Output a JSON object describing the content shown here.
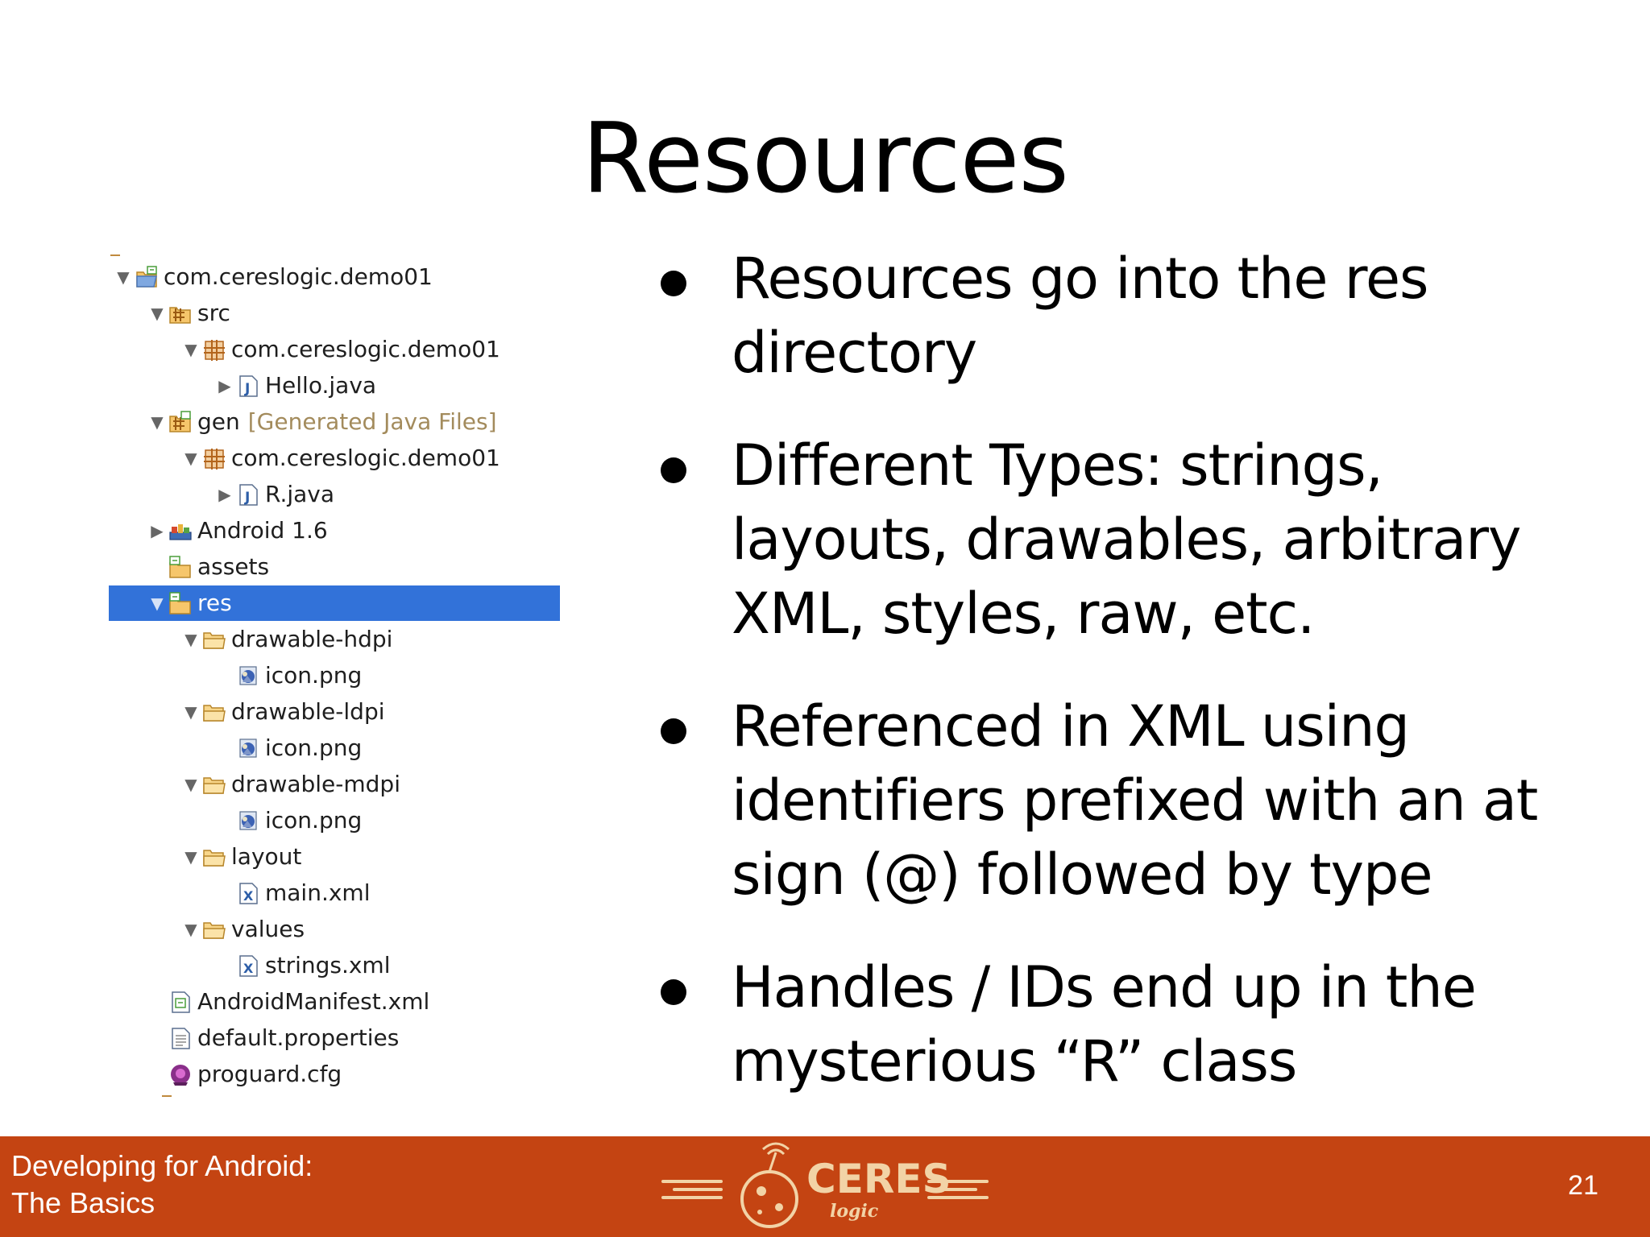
{
  "slide": {
    "title": "Resources",
    "page_number": "21"
  },
  "tree": {
    "items": [
      {
        "label": "com.cereslogic.demo01",
        "suffix": "",
        "icon": "android-project-icon",
        "twisty": "▼",
        "depth": 0,
        "selected": false
      },
      {
        "label": "src",
        "suffix": "",
        "icon": "source-folder-icon",
        "twisty": "▼",
        "depth": 1,
        "selected": false
      },
      {
        "label": "com.cereslogic.demo01",
        "suffix": "",
        "icon": "package-icon",
        "twisty": "▼",
        "depth": 2,
        "selected": false
      },
      {
        "label": "Hello.java",
        "suffix": "",
        "icon": "java-file-icon",
        "twisty": "▶",
        "depth": 3,
        "selected": false
      },
      {
        "label": "gen",
        "suffix": "[Generated Java Files]",
        "icon": "generated-folder-icon",
        "twisty": "▼",
        "depth": 1,
        "selected": false
      },
      {
        "label": "com.cereslogic.demo01",
        "suffix": "",
        "icon": "package-icon",
        "twisty": "▼",
        "depth": 2,
        "selected": false
      },
      {
        "label": "R.java",
        "suffix": "",
        "icon": "java-file-icon",
        "twisty": "▶",
        "depth": 3,
        "selected": false
      },
      {
        "label": "Android 1.6",
        "suffix": "",
        "icon": "library-icon",
        "twisty": "▶",
        "depth": 1,
        "selected": false
      },
      {
        "label": "assets",
        "suffix": "",
        "icon": "android-folder-icon",
        "twisty": "",
        "depth": 1,
        "selected": false
      },
      {
        "label": "res",
        "suffix": "",
        "icon": "android-folder-icon",
        "twisty": "▼",
        "depth": 1,
        "selected": true
      },
      {
        "label": "drawable-hdpi",
        "suffix": "",
        "icon": "folder-icon",
        "twisty": "▼",
        "depth": 2,
        "selected": false
      },
      {
        "label": "icon.png",
        "suffix": "",
        "icon": "image-file-icon",
        "twisty": "",
        "depth": 3,
        "selected": false
      },
      {
        "label": "drawable-ldpi",
        "suffix": "",
        "icon": "folder-icon",
        "twisty": "▼",
        "depth": 2,
        "selected": false
      },
      {
        "label": "icon.png",
        "suffix": "",
        "icon": "image-file-icon",
        "twisty": "",
        "depth": 3,
        "selected": false
      },
      {
        "label": "drawable-mdpi",
        "suffix": "",
        "icon": "folder-icon",
        "twisty": "▼",
        "depth": 2,
        "selected": false
      },
      {
        "label": "icon.png",
        "suffix": "",
        "icon": "image-file-icon",
        "twisty": "",
        "depth": 3,
        "selected": false
      },
      {
        "label": "layout",
        "suffix": "",
        "icon": "folder-icon",
        "twisty": "▼",
        "depth": 2,
        "selected": false
      },
      {
        "label": "main.xml",
        "suffix": "",
        "icon": "xml-file-icon",
        "twisty": "",
        "depth": 3,
        "selected": false
      },
      {
        "label": "values",
        "suffix": "",
        "icon": "folder-icon",
        "twisty": "▼",
        "depth": 2,
        "selected": false
      },
      {
        "label": "strings.xml",
        "suffix": "",
        "icon": "xml-file-icon",
        "twisty": "",
        "depth": 3,
        "selected": false
      },
      {
        "label": "AndroidManifest.xml",
        "suffix": "",
        "icon": "manifest-file-icon",
        "twisty": "",
        "depth": 1,
        "selected": false
      },
      {
        "label": "default.properties",
        "suffix": "",
        "icon": "text-file-icon",
        "twisty": "",
        "depth": 1,
        "selected": false
      },
      {
        "label": "proguard.cfg",
        "suffix": "",
        "icon": "config-file-icon",
        "twisty": "",
        "depth": 1,
        "selected": false
      }
    ]
  },
  "bullets": [
    {
      "lines": [
        "Resources go into the res",
        "directory"
      ]
    },
    {
      "lines": [
        "Different Types: strings,",
        "layouts, drawables, arbitrary",
        "XML, styles, raw, etc."
      ]
    },
    {
      "lines": [
        "Referenced in XML using",
        "identifiers prefixed with an at",
        "sign (@) followed by type"
      ]
    },
    {
      "lines": [
        "Handles / IDs end up in the",
        "mysterious “R” class"
      ]
    }
  ],
  "footer": {
    "title_line1": "Developing for Android:",
    "title_line2": "The Basics",
    "logo_word": "CERES",
    "logo_sub": "logic",
    "background": "#c44412",
    "logo_color": "#f2d3a6"
  },
  "colors": {
    "selection": "#3272d9",
    "generated_suffix": "#a38b5c"
  }
}
